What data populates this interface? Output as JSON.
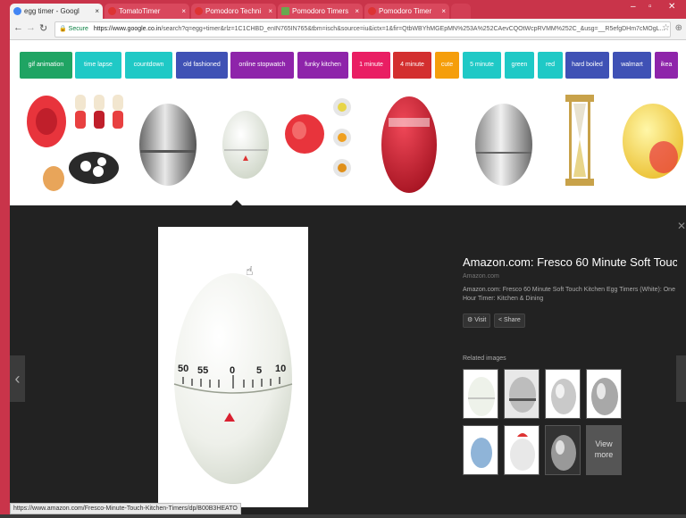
{
  "browser": {
    "tabs": [
      {
        "label": "egg timer - Googl",
        "active": true
      },
      {
        "label": "TomatoTimer",
        "active": false
      },
      {
        "label": "Pomodoro Techni",
        "active": false
      },
      {
        "label": "Pomodoro Timers",
        "active": false
      },
      {
        "label": "Pomodoro Timer",
        "active": false
      }
    ],
    "secure_label": "Secure",
    "url_prefix": "https://www.google.co.in",
    "url_rest": "/search?q=egg+timer&rlz=1C1CHBD_enIN765IN765&tbm=isch&source=iu&ictx=1&fir=QtbWBYhMGEpMN%253A%252CAevCQOtWcpRVMM%252C_&usg=__R5efgDHm7cMOgL..."
  },
  "chips": [
    {
      "label": "gif animation",
      "color": "#1fa463"
    },
    {
      "label": "time lapse",
      "color": "#1fc9c6"
    },
    {
      "label": "countdown",
      "color": "#1fc9c6"
    },
    {
      "label": "old fashioned",
      "color": "#3f51b5"
    },
    {
      "label": "online stopwatch",
      "color": "#8e24aa"
    },
    {
      "label": "funky kitchen",
      "color": "#8e24aa"
    },
    {
      "label": "1 minute",
      "color": "#e91e63"
    },
    {
      "label": "4 minute",
      "color": "#d32f2f"
    },
    {
      "label": "cute",
      "color": "#f59e0b"
    },
    {
      "label": "5 minute",
      "color": "#1fc9c6"
    },
    {
      "label": "green",
      "color": "#1fc9c6"
    },
    {
      "label": "red",
      "color": "#1fc9c6"
    },
    {
      "label": "hard boiled",
      "color": "#3f51b5"
    },
    {
      "label": "walmart",
      "color": "#3f51b5"
    },
    {
      "label": "ikea",
      "color": "#8e24aa"
    }
  ],
  "preview": {
    "title": "Amazon.com: Fresco 60 Minute Soft Touc...",
    "source": "Amazon.com",
    "description": "Amazon.com: Fresco 60 Minute Soft Touch Kitchen Egg Timers (White): One Hour Timer: Kitchen & Dining",
    "visit_label": "Visit",
    "share_label": "Share",
    "related_label": "Related images",
    "view_more_label": "View more",
    "dial_numbers": [
      "50",
      "55",
      "0",
      "5",
      "10"
    ]
  },
  "status_url": "https://www.amazon.com/Fresco-Minute-Touch-Kitchen-Timers/dp/B00B3HEATO"
}
